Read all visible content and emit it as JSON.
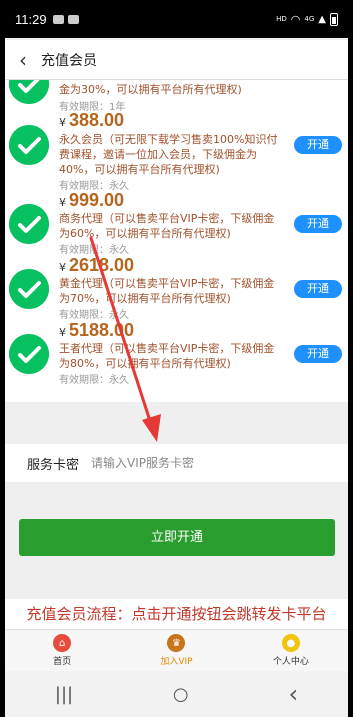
{
  "status": {
    "time": "11:29",
    "network": "HD",
    "signal": "4G"
  },
  "header": {
    "title": "充值会员"
  },
  "top_partial": {
    "desc": "金为30%，可以拥有平台所有代理权)",
    "expire": "有效期限：1年"
  },
  "items": [
    {
      "price": "388.00",
      "desc": "永久会员（可无限下载学习售卖100%知识付费课程，邀请一位加入会员，下级佣金为40%，可以拥有平台所有代理权)",
      "expire": "有效期限：永久",
      "button": "开通"
    },
    {
      "price": "999.00",
      "desc": "商务代理（可以售卖平台VIP卡密，下级佣金为60%，可以拥有平台所有代理权)",
      "expire": "有效期限：永久",
      "button": "开通"
    },
    {
      "price": "2618.00",
      "desc": "黄金代理（可以售卖平台VIP卡密，下级佣金为70%，可以拥有平台所有代理权)",
      "expire": "有效期限：永久",
      "button": "开通"
    },
    {
      "price": "5188.00",
      "desc": "王者代理（可以售卖平台VIP卡密，下级佣金为80%，可以拥有平台所有代理权)",
      "expire": "有效期限：永久",
      "button": "开通"
    }
  ],
  "currency": "¥",
  "card": {
    "label": "服务卡密",
    "placeholder": "请输入VIP服务卡密"
  },
  "submit_label": "立即开通",
  "flow_text": "充值会员流程：点击开通按钮会跳转发卡平台",
  "tabs": [
    {
      "label": "首页",
      "color": "#e74c3c"
    },
    {
      "label": "加入VIP",
      "color": "#e68a00"
    },
    {
      "label": "个人中心",
      "color": "#f1c40f"
    }
  ],
  "nav": {
    "recent": "|||",
    "home": "○",
    "back": "‹"
  },
  "colors": {
    "accent_green": "#2a9d2f",
    "open_blue": "#1e90ff",
    "arrow_red": "#e53935",
    "price_brown": "#b5651d"
  }
}
